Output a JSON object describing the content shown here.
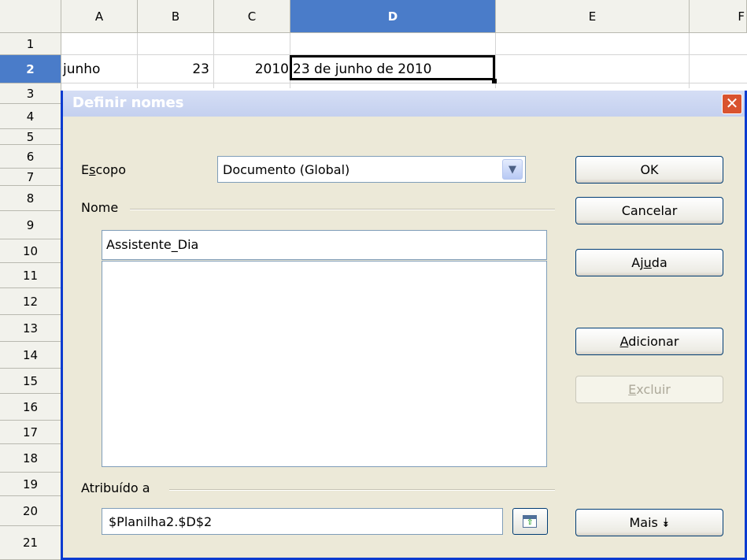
{
  "sheet": {
    "columns": [
      "A",
      "B",
      "C",
      "D",
      "E",
      "F"
    ],
    "selected_column": "D",
    "rows": [
      "1",
      "2",
      "3",
      "4",
      "5",
      "6",
      "7",
      "8",
      "9",
      "10",
      "11",
      "12",
      "13",
      "14",
      "15",
      "16",
      "17",
      "18",
      "19",
      "20",
      "21"
    ],
    "selected_row": "2",
    "cells": {
      "A2": "junho",
      "B2": "23",
      "C2": "2010",
      "D2": "23 de junho de 2010"
    }
  },
  "dialog": {
    "title": "Definir nomes",
    "close_symbol": "✕",
    "scope_label_pre": "E",
    "scope_label_accel": "s",
    "scope_label_post": "copo",
    "scope_value": "Documento (Global)",
    "name_group_label": "Nome",
    "name_value": "Assistente_Dia",
    "assigned_label": "Atribuído a",
    "assigned_value": "$Planilha2.$D$2",
    "buttons": {
      "ok": "OK",
      "cancel": "Cancelar",
      "help_pre": "Aj",
      "help_accel": "u",
      "help_post": "da",
      "add_accel": "A",
      "add_post": "dicionar",
      "delete_accel": "E",
      "delete_post": "xcluir",
      "more": "Mais ⯯"
    },
    "icons": {
      "dropdown": "chevron-down-icon",
      "shrink": "shrink-dialog-icon",
      "close": "close-icon"
    }
  }
}
